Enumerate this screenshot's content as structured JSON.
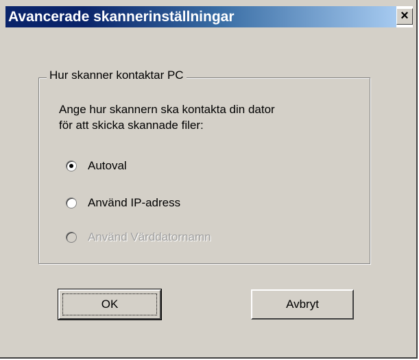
{
  "dialog": {
    "title": "Avancerade skannerinställningar",
    "close_label": "×"
  },
  "group": {
    "legend": "Hur skanner kontaktar PC",
    "description_line1": "Ange hur skannern ska kontakta din dator",
    "description_line2": "för att skicka skannade filer:"
  },
  "options": [
    {
      "label": "Autoval",
      "checked": true,
      "enabled": true
    },
    {
      "label": "Använd IP-adress",
      "checked": false,
      "enabled": true
    },
    {
      "label": "Använd Värddatornamn",
      "checked": false,
      "enabled": false
    }
  ],
  "buttons": {
    "ok_label": "OK",
    "cancel_label": "Avbryt"
  },
  "colors": {
    "title_start": "#0a246a",
    "title_end": "#a6caf0",
    "face": "#d4d0c8"
  }
}
